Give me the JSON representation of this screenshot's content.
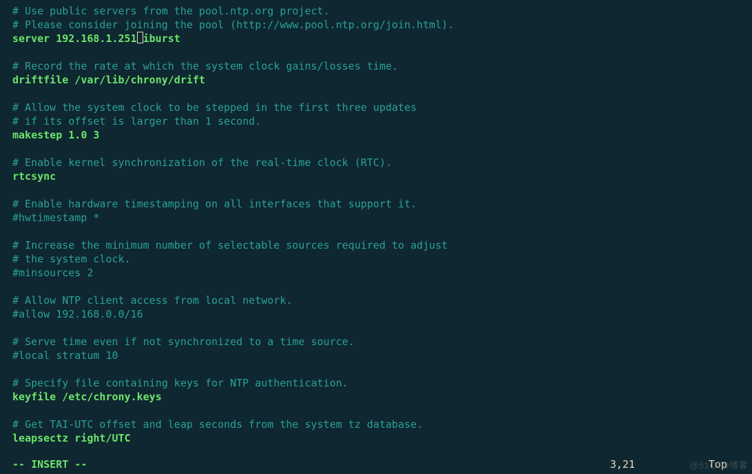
{
  "file": {
    "lines": [
      {
        "type": "comment",
        "text": "# Use public servers from the pool.ntp.org project."
      },
      {
        "type": "comment",
        "text": "# Please consider joining the pool (http://www.pool.ntp.org/join.html)."
      },
      {
        "type": "server",
        "prefix": "server 192.168.1.251",
        "cursor": true,
        "suffix": "iburst"
      },
      {
        "type": "blank",
        "text": ""
      },
      {
        "type": "comment",
        "text": "# Record the rate at which the system clock gains/losses time."
      },
      {
        "type": "keyword",
        "text": "driftfile /var/lib/chrony/drift"
      },
      {
        "type": "blank",
        "text": ""
      },
      {
        "type": "comment",
        "text": "# Allow the system clock to be stepped in the first three updates"
      },
      {
        "type": "comment",
        "text": "# if its offset is larger than 1 second."
      },
      {
        "type": "keyword",
        "text": "makestep 1.0 3"
      },
      {
        "type": "blank",
        "text": ""
      },
      {
        "type": "comment",
        "text": "# Enable kernel synchronization of the real-time clock (RTC)."
      },
      {
        "type": "keyword",
        "text": "rtcsync"
      },
      {
        "type": "blank",
        "text": ""
      },
      {
        "type": "comment",
        "text": "# Enable hardware timestamping on all interfaces that support it."
      },
      {
        "type": "comment",
        "text": "#hwtimestamp *"
      },
      {
        "type": "blank",
        "text": ""
      },
      {
        "type": "comment",
        "text": "# Increase the minimum number of selectable sources required to adjust"
      },
      {
        "type": "comment",
        "text": "# the system clock."
      },
      {
        "type": "comment",
        "text": "#minsources 2"
      },
      {
        "type": "blank",
        "text": ""
      },
      {
        "type": "comment",
        "text": "# Allow NTP client access from local network."
      },
      {
        "type": "comment",
        "text": "#allow 192.168.0.0/16"
      },
      {
        "type": "blank",
        "text": ""
      },
      {
        "type": "comment",
        "text": "# Serve time even if not synchronized to a time source."
      },
      {
        "type": "comment",
        "text": "#local stratum 10"
      },
      {
        "type": "blank",
        "text": ""
      },
      {
        "type": "comment",
        "text": "# Specify file containing keys for NTP authentication."
      },
      {
        "type": "keyword",
        "text": "keyfile /etc/chrony.keys"
      },
      {
        "type": "blank",
        "text": ""
      },
      {
        "type": "comment",
        "text": "# Get TAI-UTC offset and leap seconds from the system tz database."
      },
      {
        "type": "keyword",
        "text": "leapsectz right/UTC"
      },
      {
        "type": "blank",
        "text": ""
      }
    ]
  },
  "status": {
    "mode": "-- INSERT --",
    "position": "3,21",
    "view": "Top"
  },
  "watermark": "@51CTO博客"
}
